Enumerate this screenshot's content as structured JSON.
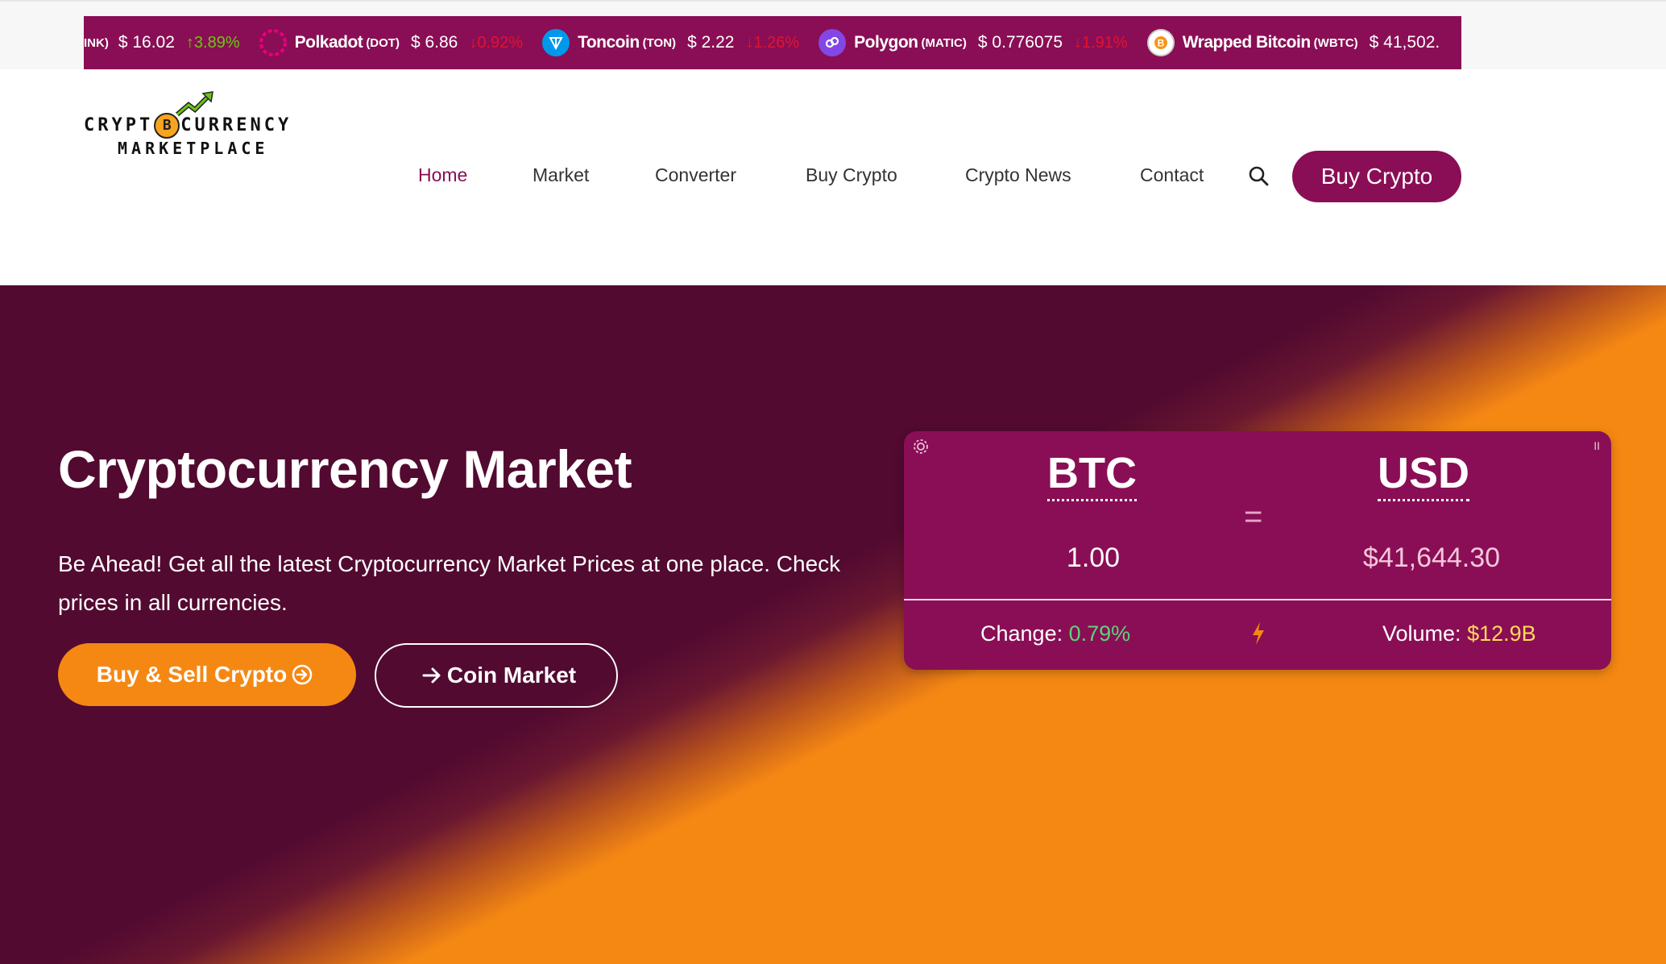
{
  "ticker": [
    {
      "name": "",
      "symbol": "INK)",
      "price": "$ 16.02",
      "change": "3.89%",
      "direction": "up",
      "icon": "",
      "icon_color": ""
    },
    {
      "name": "Polkadot",
      "symbol": "(DOT)",
      "price": "$ 6.86",
      "change": "0.92%",
      "direction": "down",
      "icon": "polkadot-icon",
      "icon_color": "#e6007a"
    },
    {
      "name": "Toncoin",
      "symbol": "(TON)",
      "price": "$ 2.22",
      "change": "1.26%",
      "direction": "down",
      "icon": "toncoin-icon",
      "icon_color": "#0098ea"
    },
    {
      "name": "Polygon",
      "symbol": "(MATIC)",
      "price": "$ 0.776075",
      "change": "1.91%",
      "direction": "down",
      "icon": "polygon-icon",
      "icon_color": "#8247e5"
    },
    {
      "name": "Wrapped Bitcoin",
      "symbol": "(WBTC)",
      "price": "$ 41,502.",
      "change": "",
      "direction": "",
      "icon": "wbtc-icon",
      "icon_color": "#f7931a"
    }
  ],
  "logo": {
    "line1_start": "CRYPT",
    "line1_badge": "B",
    "line1_end": "CURRENCY",
    "line2": "MARKETPLACE"
  },
  "nav": [
    {
      "label": "Home",
      "active": true
    },
    {
      "label": "Market",
      "active": false
    },
    {
      "label": "Converter",
      "active": false
    },
    {
      "label": "Buy Crypto",
      "active": false
    },
    {
      "label": "Crypto News",
      "active": false
    },
    {
      "label": "Contact",
      "active": false
    }
  ],
  "header": {
    "cta_label": "Buy Crypto"
  },
  "hero": {
    "title": "Cryptocurrency Market",
    "subtitle": "Be Ahead! Get all the latest Cryptocurrency Market Prices at one place. Check prices in all currencies.",
    "primary_button": "Buy & Sell Crypto",
    "secondary_button": "Coin Market"
  },
  "converter": {
    "from_code": "BTC",
    "to_code": "USD",
    "equals": "=",
    "from_amount": "1.00",
    "to_amount": "$41,644.30",
    "change_label": "Change:",
    "change_value": "0.79%",
    "volume_label": "Volume:",
    "volume_value": "$12.9B",
    "pause_label": "II"
  },
  "colors": {
    "brand": "#8a0e55",
    "hero_bg": "#520a30",
    "accent": "#f58813",
    "up": "#6cc614",
    "down": "#e01430"
  }
}
